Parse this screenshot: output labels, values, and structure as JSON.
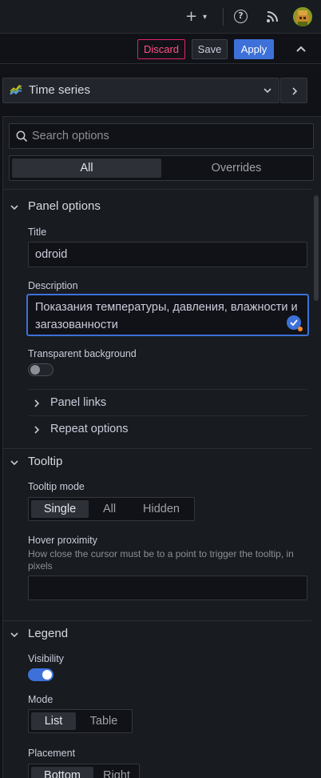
{
  "header": {
    "plus_icon": "plus-icon",
    "help_icon": "help-icon",
    "rss_icon": "rss-icon",
    "avatar_icon": "avatar"
  },
  "actions": {
    "discard": "Discard",
    "save": "Save",
    "apply": "Apply"
  },
  "viz": {
    "label": "Time series"
  },
  "search": {
    "placeholder": "Search options",
    "value": ""
  },
  "tabs": {
    "all": "All",
    "overrides": "Overrides"
  },
  "panel_options": {
    "title": "Panel options",
    "title_label": "Title",
    "title_value": "odroid",
    "description_label": "Description",
    "description_value": "Показания температуры, давления, влажности и загазованности",
    "transparent_label": "Transparent background",
    "transparent_on": false,
    "panel_links": "Panel links",
    "repeat_options": "Repeat options"
  },
  "tooltip": {
    "title": "Tooltip",
    "mode_label": "Tooltip mode",
    "modes": [
      "Single",
      "All",
      "Hidden"
    ],
    "selected_mode": "Single",
    "hover_label": "Hover proximity",
    "hover_description": "How close the cursor must be to a point to trigger the tooltip, in pixels",
    "hover_value": ""
  },
  "legend": {
    "title": "Legend",
    "visibility_label": "Visibility",
    "visibility_on": true,
    "mode_label": "Mode",
    "modes": [
      "List",
      "Table"
    ],
    "selected_mode": "List",
    "placement_label": "Placement",
    "placements": [
      "Bottom",
      "Right"
    ],
    "selected_placement": "Bottom"
  },
  "colors": {
    "accent": "#3d71d9",
    "discard": "#ff5286",
    "background": "#111217",
    "panel": "#181b1f"
  }
}
